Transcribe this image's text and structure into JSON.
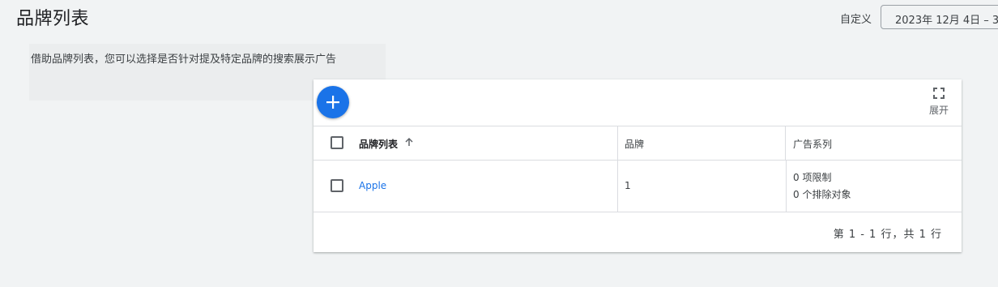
{
  "header": {
    "title": "品牌列表",
    "date_range_label": "自定义",
    "date_range_value": "2023年 12月 4日 – 3"
  },
  "description": "借助品牌列表，您可以选择是否针对提及特定品牌的搜索展示广告",
  "toolbar": {
    "add_icon": "plus-icon",
    "expand_label": "展开",
    "expand_icon": "fullscreen-icon"
  },
  "table": {
    "columns": [
      "品牌列表",
      "品牌",
      "广告系列"
    ],
    "sort_icon": "arrow-upward-icon",
    "rows": [
      {
        "name": "Apple",
        "brands": "1",
        "restrictions": "0 项限制",
        "exclusions": "0 个排除对象"
      }
    ],
    "pagination": "第 1 - 1 行，共 1 行"
  },
  "colors": {
    "accent": "#1a73e8",
    "background": "#f1f3f4"
  }
}
